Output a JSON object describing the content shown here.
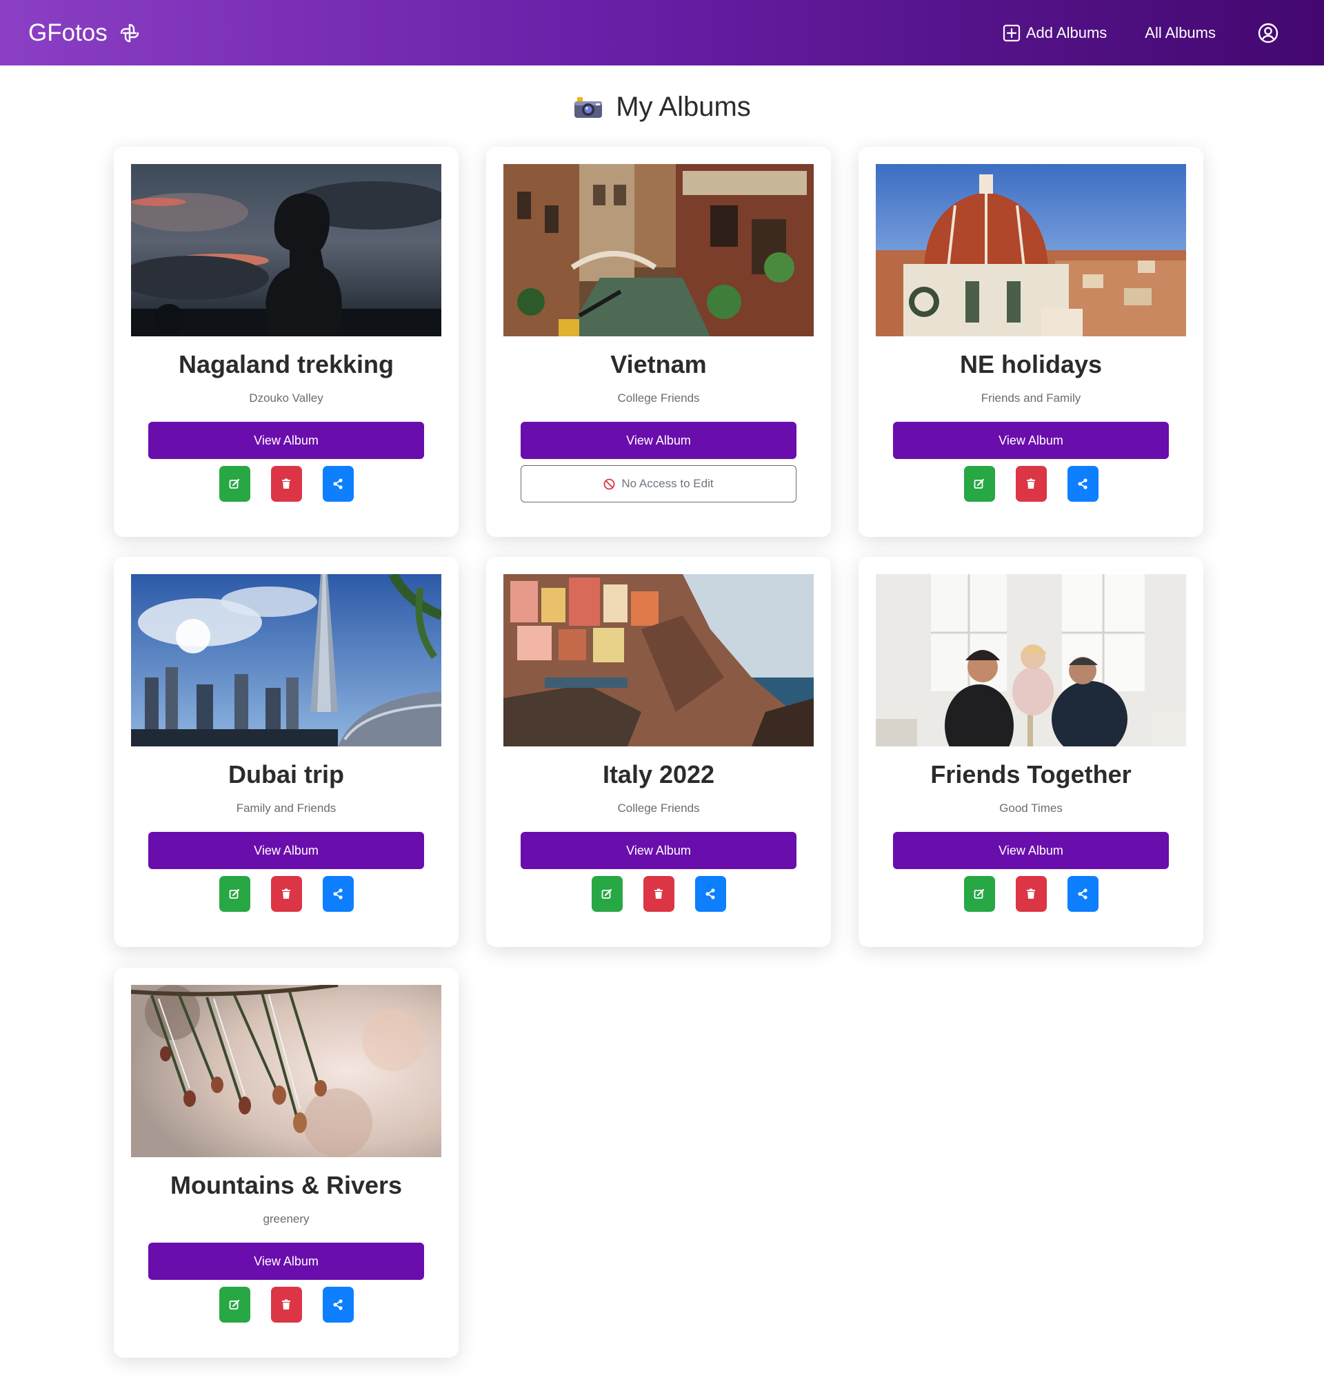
{
  "navbar": {
    "brand": "GFotos",
    "add_albums": "Add Albums",
    "all_albums": "All Albums"
  },
  "page": {
    "title": "My Albums"
  },
  "albums": [
    {
      "title": "Nagaland trekking",
      "subtitle": "Dzouko Valley",
      "view_label": "View Album",
      "editable": true
    },
    {
      "title": "Vietnam",
      "subtitle": "College Friends",
      "view_label": "View Album",
      "editable": false,
      "no_access_label": "No Access to Edit"
    },
    {
      "title": "NE holidays",
      "subtitle": "Friends and Family",
      "view_label": "View Album",
      "editable": true
    },
    {
      "title": "Dubai trip",
      "subtitle": "Family and Friends",
      "view_label": "View Album",
      "editable": true
    },
    {
      "title": "Italy 2022",
      "subtitle": "College Friends",
      "view_label": "View Album",
      "editable": true
    },
    {
      "title": "Friends Together",
      "subtitle": "Good Times",
      "view_label": "View Album",
      "editable": true
    },
    {
      "title": "Mountains & Rivers",
      "subtitle": "greenery",
      "view_label": "View Album",
      "editable": true
    }
  ],
  "colors": {
    "nav_start": "#8a3fc4",
    "nav_end": "#43086f",
    "primary_button": "#6a0dad",
    "edit_button": "#28a745",
    "delete_button": "#dc3545",
    "share_button": "#0d7fff"
  },
  "icons": {
    "brand": "aperture-icon",
    "add": "plus-square-icon",
    "profile": "user-circle-icon",
    "title": "camera-icon",
    "edit": "edit-icon",
    "delete": "trash-icon",
    "share": "share-icon",
    "no_access": "ban-icon"
  }
}
